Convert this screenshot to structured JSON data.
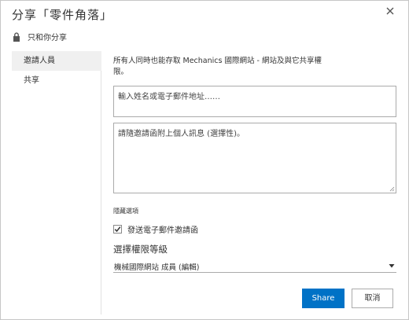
{
  "dialog": {
    "title": "分享「零件角落」",
    "close_icon": "close-icon"
  },
  "share_mode": {
    "icon": "lock-icon",
    "label": "只和你分享"
  },
  "sidebar": {
    "items": [
      {
        "label": "邀請人員",
        "active": true
      },
      {
        "label": "共享",
        "active": false
      }
    ]
  },
  "main": {
    "description": "所有人同時也能存取 Mechanics 國際網站 - 網站及與它共享權限。",
    "names_input": {
      "placeholder": "輸入姓名或電子郵件地址……"
    },
    "message_input": {
      "placeholder": "請隨邀請函附上個人訊息 (選擇性)。"
    },
    "options_title": "隱藏選項",
    "send_email": {
      "label": "發送電子郵件邀請函",
      "checked": true
    },
    "permission": {
      "title": "選擇權限等級",
      "selected": "機械國際網站 成員 (編輯)"
    },
    "buttons": {
      "share": "Share",
      "cancel": "取消"
    }
  },
  "colors": {
    "accent": "#0072c6",
    "sidebar_active": "#f0f0f0",
    "border": "#ababab"
  }
}
